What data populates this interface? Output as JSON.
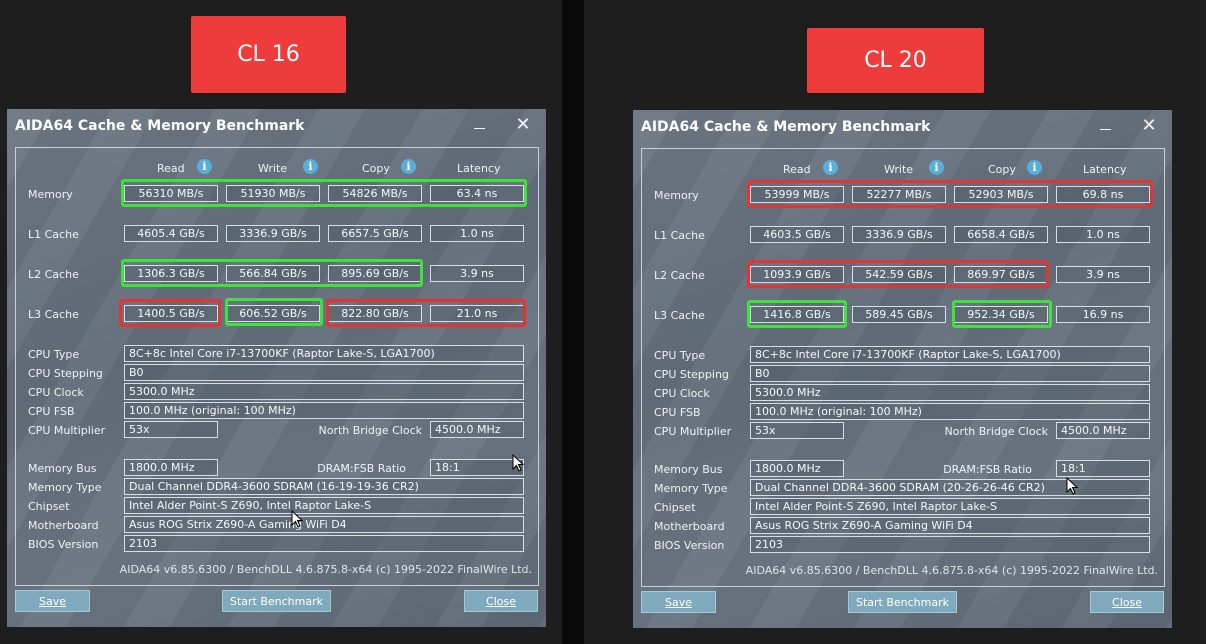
{
  "badges": [
    {
      "text": "CL 16"
    },
    {
      "text": "CL 20"
    }
  ],
  "windows": [
    {
      "title": "AIDA64 Cache & Memory Benchmark",
      "headers": {
        "read": "Read",
        "write": "Write",
        "copy": "Copy",
        "latency": "Latency"
      },
      "rows": [
        {
          "label": "Memory",
          "read": "56310 MB/s",
          "write": "51930 MB/s",
          "copy": "54826 MB/s",
          "latency": "63.4 ns"
        },
        {
          "label": "L1 Cache",
          "read": "4605.4 GB/s",
          "write": "3336.9 GB/s",
          "copy": "6657.5 GB/s",
          "latency": "1.0 ns"
        },
        {
          "label": "L2 Cache",
          "read": "1306.3 GB/s",
          "write": "566.84 GB/s",
          "copy": "895.69 GB/s",
          "latency": "3.9 ns"
        },
        {
          "label": "L3 Cache",
          "read": "1400.5 GB/s",
          "write": "606.52 GB/s",
          "copy": "822.80 GB/s",
          "latency": "21.0 ns"
        }
      ],
      "info": {
        "cpu_type_label": "CPU Type",
        "cpu_type": "8C+8c Intel Core i7-13700KF  (Raptor Lake-S, LGA1700)",
        "cpu_stepping_label": "CPU Stepping",
        "cpu_stepping": "B0",
        "cpu_clock_label": "CPU Clock",
        "cpu_clock": "5300.0 MHz",
        "cpu_fsb_label": "CPU FSB",
        "cpu_fsb": "100.0 MHz  (original: 100 MHz)",
        "cpu_multiplier_label": "CPU Multiplier",
        "cpu_multiplier": "53x",
        "nb_clock_label": "North Bridge Clock",
        "nb_clock": "4500.0 MHz",
        "memory_bus_label": "Memory Bus",
        "memory_bus": "1800.0 MHz",
        "dram_fsb_label": "DRAM:FSB Ratio",
        "dram_fsb": "18:1",
        "memory_type_label": "Memory Type",
        "memory_type": "Dual Channel DDR4-3600 SDRAM  (16-19-19-36 CR2)",
        "chipset_label": "Chipset",
        "chipset": "Intel Alder Point-S Z690, Intel Raptor Lake-S",
        "motherboard_label": "Motherboard",
        "motherboard": "Asus ROG Strix Z690-A Gaming WiFi D4",
        "bios_label": "BIOS Version",
        "bios": "2103"
      },
      "footer": "AIDA64 v6.85.6300 / BenchDLL 4.6.875.8-x64  (c) 1995-2022 FinalWire Ltd.",
      "buttons": {
        "save": "Save",
        "start": "Start Benchmark",
        "close": "Close"
      }
    },
    {
      "title": "AIDA64 Cache & Memory Benchmark",
      "headers": {
        "read": "Read",
        "write": "Write",
        "copy": "Copy",
        "latency": "Latency"
      },
      "rows": [
        {
          "label": "Memory",
          "read": "53999 MB/s",
          "write": "52277 MB/s",
          "copy": "52903 MB/s",
          "latency": "69.8 ns"
        },
        {
          "label": "L1 Cache",
          "read": "4603.5 GB/s",
          "write": "3336.9 GB/s",
          "copy": "6658.4 GB/s",
          "latency": "1.0 ns"
        },
        {
          "label": "L2 Cache",
          "read": "1093.9 GB/s",
          "write": "542.59 GB/s",
          "copy": "869.97 GB/s",
          "latency": "3.9 ns"
        },
        {
          "label": "L3 Cache",
          "read": "1416.8 GB/s",
          "write": "589.45 GB/s",
          "copy": "952.34 GB/s",
          "latency": "16.9 ns"
        }
      ],
      "info": {
        "cpu_type_label": "CPU Type",
        "cpu_type": "8C+8c Intel Core i7-13700KF  (Raptor Lake-S, LGA1700)",
        "cpu_stepping_label": "CPU Stepping",
        "cpu_stepping": "B0",
        "cpu_clock_label": "CPU Clock",
        "cpu_clock": "5300.0 MHz",
        "cpu_fsb_label": "CPU FSB",
        "cpu_fsb": "100.0 MHz  (original: 100 MHz)",
        "cpu_multiplier_label": "CPU Multiplier",
        "cpu_multiplier": "53x",
        "nb_clock_label": "North Bridge Clock",
        "nb_clock": "4500.0 MHz",
        "memory_bus_label": "Memory Bus",
        "memory_bus": "1800.0 MHz",
        "dram_fsb_label": "DRAM:FSB Ratio",
        "dram_fsb": "18:1",
        "memory_type_label": "Memory Type",
        "memory_type": "Dual Channel DDR4-3600 SDRAM  (20-26-26-46 CR2)",
        "chipset_label": "Chipset",
        "chipset": "Intel Alder Point-S Z690, Intel Raptor Lake-S",
        "motherboard_label": "Motherboard",
        "motherboard": "Asus ROG Strix Z690-A Gaming WiFi D4",
        "bios_label": "BIOS Version",
        "bios": "2103"
      },
      "footer": "AIDA64 v6.85.6300 / BenchDLL 4.6.875.8-x64  (c) 1995-2022 FinalWire Ltd.",
      "buttons": {
        "save": "Save",
        "start": "Start Benchmark",
        "close": "Close"
      }
    }
  ],
  "colors": {
    "highlight_better": "#3de23d",
    "highlight_worse": "#e33333",
    "badge": "#ee3b3b"
  }
}
